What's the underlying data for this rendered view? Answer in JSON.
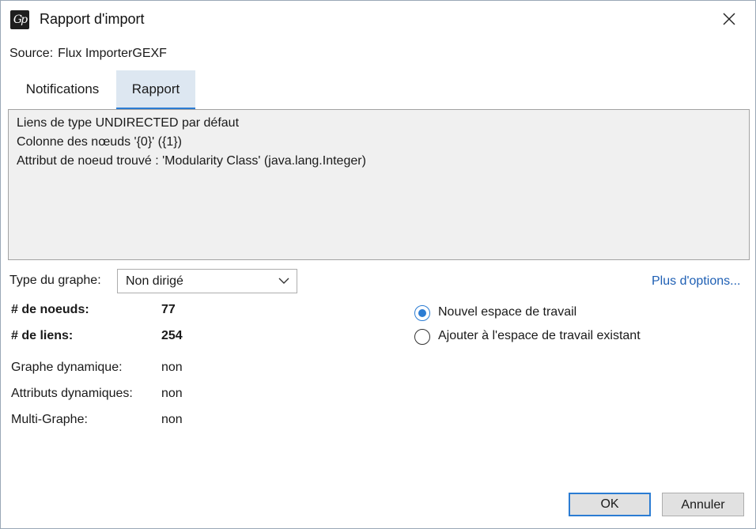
{
  "window": {
    "title": "Rapport d'import",
    "icon": "gephi-app-icon"
  },
  "source": {
    "label": "Source:",
    "value": "Flux ImporterGEXF"
  },
  "tabs": [
    {
      "label": "Notifications",
      "selected": false
    },
    {
      "label": "Rapport",
      "selected": true
    }
  ],
  "report": {
    "lines": [
      "Liens de type UNDIRECTED par défaut",
      "Colonne des nœuds '{0}' ({1})",
      "Attribut de noeud trouvé : 'Modularity Class' (java.lang.Integer)"
    ]
  },
  "graph_type": {
    "label": "Type du graphe:",
    "value": "Non dirigé"
  },
  "more_options": "Plus d'options...",
  "stats": {
    "nodes": {
      "label": "# de noeuds:",
      "value": "77"
    },
    "edges": {
      "label": "# de liens:",
      "value": "254"
    },
    "dynamic": {
      "label": "Graphe dynamique:",
      "value": "non"
    },
    "dynamic_attrs": {
      "label": "Attributs dynamiques:",
      "value": "non"
    },
    "multi": {
      "label": "Multi-Graphe:",
      "value": "non"
    }
  },
  "workspace": {
    "options": [
      {
        "label": "Nouvel espace de travail",
        "selected": true
      },
      {
        "label": "Ajouter à l'espace de travail existant",
        "selected": false
      }
    ]
  },
  "buttons": {
    "ok": "OK",
    "cancel": "Annuler"
  },
  "colors": {
    "accent": "#2b7cd3",
    "link": "#1e5fb4",
    "report_bg": "#f0f0f0",
    "tab_selected_bg": "#dde7f1"
  }
}
